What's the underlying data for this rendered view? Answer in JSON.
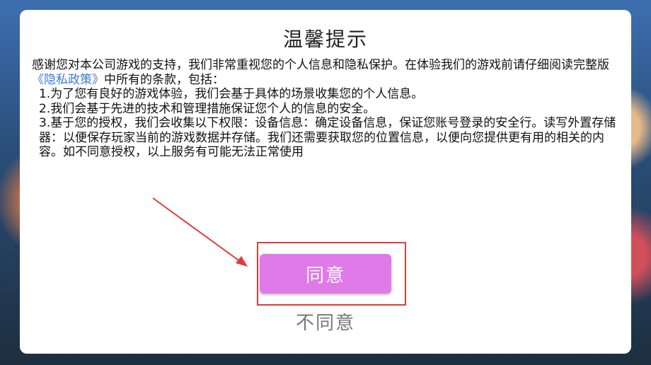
{
  "dialog": {
    "title": "温馨提示",
    "intro_before_link": "感谢您对本公司游戏的支持，我们非常重视您的个人信息和隐私保护。在体验我们的游戏前请仔细阅读完整版",
    "privacy_link": "《隐私政策》",
    "intro_after_link": "中所有的条款，包括：",
    "items": [
      "1.为了您有良好的游戏体验，我们会基于具体的场景收集您的个人信息。",
      "2.我们会基于先进的技术和管理措施保证您个人的信息的安全。",
      "3.基于您的授权，我们会收集以下权限：设备信息：确定设备信息，保证您账号登录的安全行。读写外置存储器：以便保存玩家当前的游戏数据并存储。我们还需要获取您的位置信息，以便向您提供更有用的相关的内容。如不同意授权，以上服务有可能无法正常使用"
    ],
    "agree_label": "同意",
    "disagree_label": "不同意"
  },
  "colors": {
    "agree_button": "#e07ae8",
    "link": "#3a7bd5",
    "highlight": "#e23a3a"
  }
}
